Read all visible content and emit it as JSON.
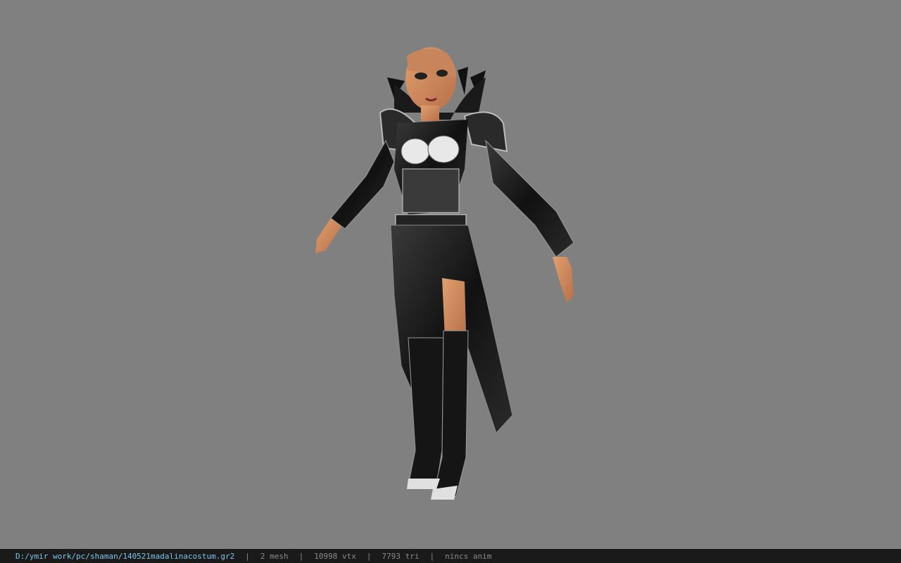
{
  "viewer": {
    "background_color": "#808080",
    "model_icon": "character-model-icon"
  },
  "statusbar": {
    "path": "D:/ymir work/pc/shaman/140521madalinacostum.gr2",
    "separator": "|",
    "mesh": "2 mesh",
    "vertices": "10998 vtx",
    "triangles": "7793 tri",
    "animation": "nincs anim",
    "path_color": "#7fc4e8",
    "text_color": "#8a8a8a"
  }
}
